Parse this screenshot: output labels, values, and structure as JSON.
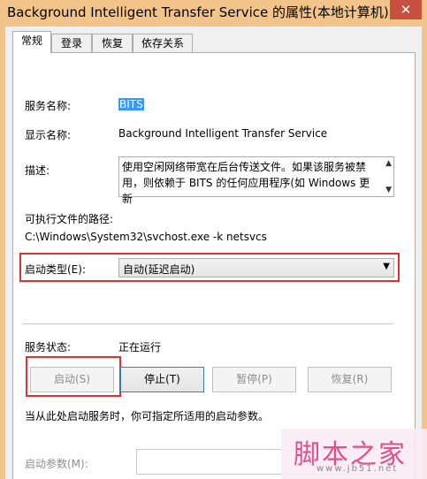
{
  "window": {
    "title": "Background Intelligent Transfer Service 的属性(本地计算机)",
    "close_label": "✕"
  },
  "tabs": [
    {
      "label": "常规",
      "active": true
    },
    {
      "label": "登录",
      "active": false
    },
    {
      "label": "恢复",
      "active": false
    },
    {
      "label": "依存关系",
      "active": false
    }
  ],
  "general": {
    "service_name_label": "服务名称:",
    "service_name_value": "BITS",
    "display_name_label": "显示名称:",
    "display_name_value": "Background Intelligent Transfer Service",
    "description_label": "描述:",
    "description_value": "使用空闲网络带宽在后台传送文件。如果该服务被禁用，则依赖于 BITS 的任何应用程序(如 Windows 更新",
    "exe_path_label": "可执行文件的路径:",
    "exe_path_value": "C:\\Windows\\System32\\svchost.exe -k netsvcs",
    "startup_type_label": "启动类型(E):",
    "startup_type_value": "自动(延迟启动)",
    "service_status_label": "服务状态:",
    "service_status_value": "正在运行",
    "buttons": {
      "start": "启动(S)",
      "stop": "停止(T)",
      "pause": "暂停(P)",
      "resume": "恢复(R)"
    },
    "hint": "当从此处启动服务时，你可指定所适用的启动参数。",
    "start_params_label": "启动参数(M):",
    "start_params_value": ""
  },
  "watermark": {
    "text": "脚本之家",
    "url": "www.jb51.net"
  },
  "colors": {
    "title_bar": "#f2c48a",
    "highlight": "#d93333",
    "selection": "#3399ff"
  }
}
